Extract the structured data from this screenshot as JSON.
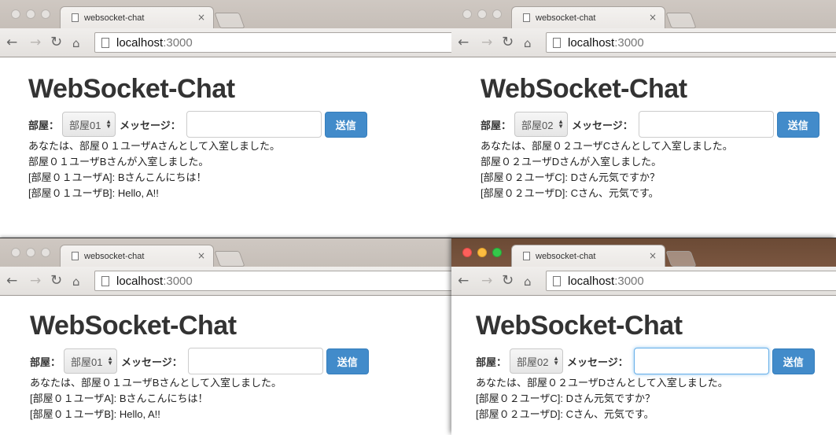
{
  "windows": [
    {
      "tab_title": "websocket-chat",
      "tab_close": "×",
      "url_host": "localhost",
      "url_port": ":3000",
      "heading": "WebSocket-Chat",
      "room_label": "部屋：",
      "room_value": "部屋01",
      "message_label": "メッセージ：",
      "message_value": "",
      "send_label": "送信",
      "log": [
        "あなたは、部屋０１ユーザAさんとして入室しました。",
        "部屋０１ユーザBさんが入室しました。",
        "[部屋０１ユーザA]: Bさんこんにちは！",
        "[部屋０１ユーザB]: Hello, A!!"
      ]
    },
    {
      "tab_title": "websocket-chat",
      "tab_close": "×",
      "url_host": "localhost",
      "url_port": ":3000",
      "heading": "WebSocket-Chat",
      "room_label": "部屋：",
      "room_value": "部屋02",
      "message_label": "メッセージ：",
      "message_value": "",
      "send_label": "送信",
      "log": [
        "あなたは、部屋０２ユーザCさんとして入室しました。",
        "部屋０２ユーザDさんが入室しました。",
        "[部屋０２ユーザC]: Dさん元気ですか？",
        "[部屋０２ユーザD]: Cさん、元気です。"
      ]
    },
    {
      "tab_title": "websocket-chat",
      "tab_close": "×",
      "url_host": "localhost",
      "url_port": ":3000",
      "heading": "WebSocket-Chat",
      "room_label": "部屋：",
      "room_value": "部屋01",
      "message_label": "メッセージ：",
      "message_value": "",
      "send_label": "送信",
      "log": [
        "あなたは、部屋０１ユーザBさんとして入室しました。",
        "[部屋０１ユーザA]: Bさんこんにちは！",
        "[部屋０１ユーザB]: Hello, A!!"
      ]
    },
    {
      "tab_title": "websocket-chat",
      "tab_close": "×",
      "url_host": "localhost",
      "url_port": ":3000",
      "heading": "WebSocket-Chat",
      "room_label": "部屋：",
      "room_value": "部屋02",
      "message_label": "メッセージ：",
      "message_value": "",
      "send_label": "送信",
      "log": [
        "あなたは、部屋０２ユーザDさんとして入室しました。",
        "[部屋０２ユーザC]: Dさん元気ですか？",
        "[部屋０２ユーザD]: Cさん、元気です。"
      ]
    }
  ],
  "icons": {
    "back": "←",
    "forward": "→",
    "reload": "↻",
    "home": "⌂",
    "select_up": "▲",
    "select_down": "▼"
  },
  "colors": {
    "primary_button": "#428bca",
    "focus_ring": "#66afe9",
    "close_light": "#fc605b",
    "minimize_light": "#fdbc40",
    "zoom_light": "#34c84a"
  }
}
